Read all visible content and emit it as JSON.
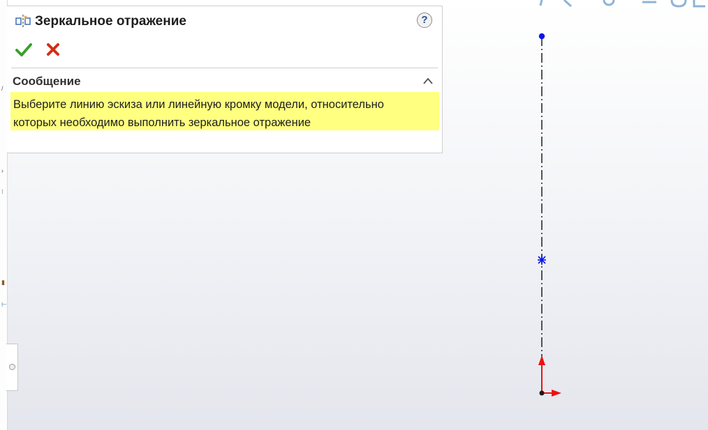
{
  "property_manager": {
    "title": "Зеркальное отражение",
    "icon": "mirror-entities-icon",
    "help_icon": "help-icon",
    "help_label": "?",
    "ok_icon": "check-icon",
    "cancel_icon": "close-icon",
    "message_section": {
      "title": "Сообщение",
      "collapse_icon": "chevron-up-icon",
      "lines": [
        "Выберите линию эскиза или линейную кромку модели, относительно",
        "которых необходимо выполнить зеркальное отражение"
      ],
      "background": "#ffff80"
    }
  },
  "colors": {
    "ok": "#3aa12b",
    "cancel": "#d42e12",
    "centerline": "#2b2b2b",
    "endpoint": "#0a16e6",
    "origin_arrow": "#ee1111"
  },
  "graphics": {
    "centerline": "sketch-centerline",
    "endpoint": "endpoint-icon",
    "midpoint": "midpoint-marker-icon",
    "origin": "origin-icon"
  }
}
